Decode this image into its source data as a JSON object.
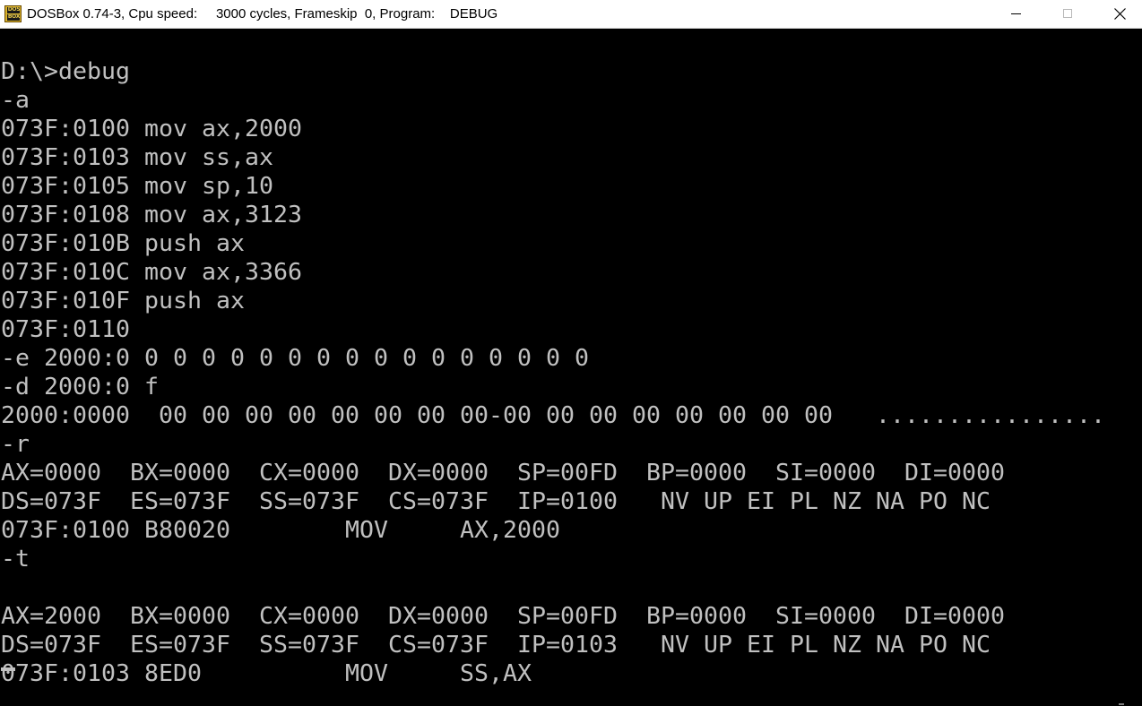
{
  "window": {
    "title": "DOSBox 0.74-3, Cpu speed:     3000 cycles, Frameskip  0, Program:    DEBUG",
    "icon": "dosbox-app-icon",
    "icon_text_top": "DOS",
    "icon_text_bottom": "BOX",
    "controls": {
      "minimize": "minimize-icon",
      "maximize": "maximize-icon",
      "close": "close-icon"
    }
  },
  "colors": {
    "background": "#000000",
    "text": "#c0c0c0",
    "titlebar": "#ffffff"
  },
  "terminal": {
    "lines": [
      "",
      "D:\\>debug",
      "-a",
      "073F:0100 mov ax,2000",
      "073F:0103 mov ss,ax",
      "073F:0105 mov sp,10",
      "073F:0108 mov ax,3123",
      "073F:010B push ax",
      "073F:010C mov ax,3366",
      "073F:010F push ax",
      "073F:0110",
      "-e 2000:0 0 0 0 0 0 0 0 0 0 0 0 0 0 0 0 0",
      "-d 2000:0 f",
      "2000:0000  00 00 00 00 00 00 00 00-00 00 00 00 00 00 00 00   ................",
      "-r",
      "AX=0000  BX=0000  CX=0000  DX=0000  SP=00FD  BP=0000  SI=0000  DI=0000",
      "DS=073F  ES=073F  SS=073F  CS=073F  IP=0100   NV UP EI PL NZ NA PO NC",
      "073F:0100 B80020        MOV     AX,2000",
      "-t",
      "",
      "AX=2000  BX=0000  CX=0000  DX=0000  SP=00FD  BP=0000  SI=0000  DI=0000",
      "DS=073F  ES=073F  SS=073F  CS=073F  IP=0103   NV UP EI PL NZ NA PO NC",
      "073F:0103 8ED0          MOV     SS,AX"
    ]
  }
}
